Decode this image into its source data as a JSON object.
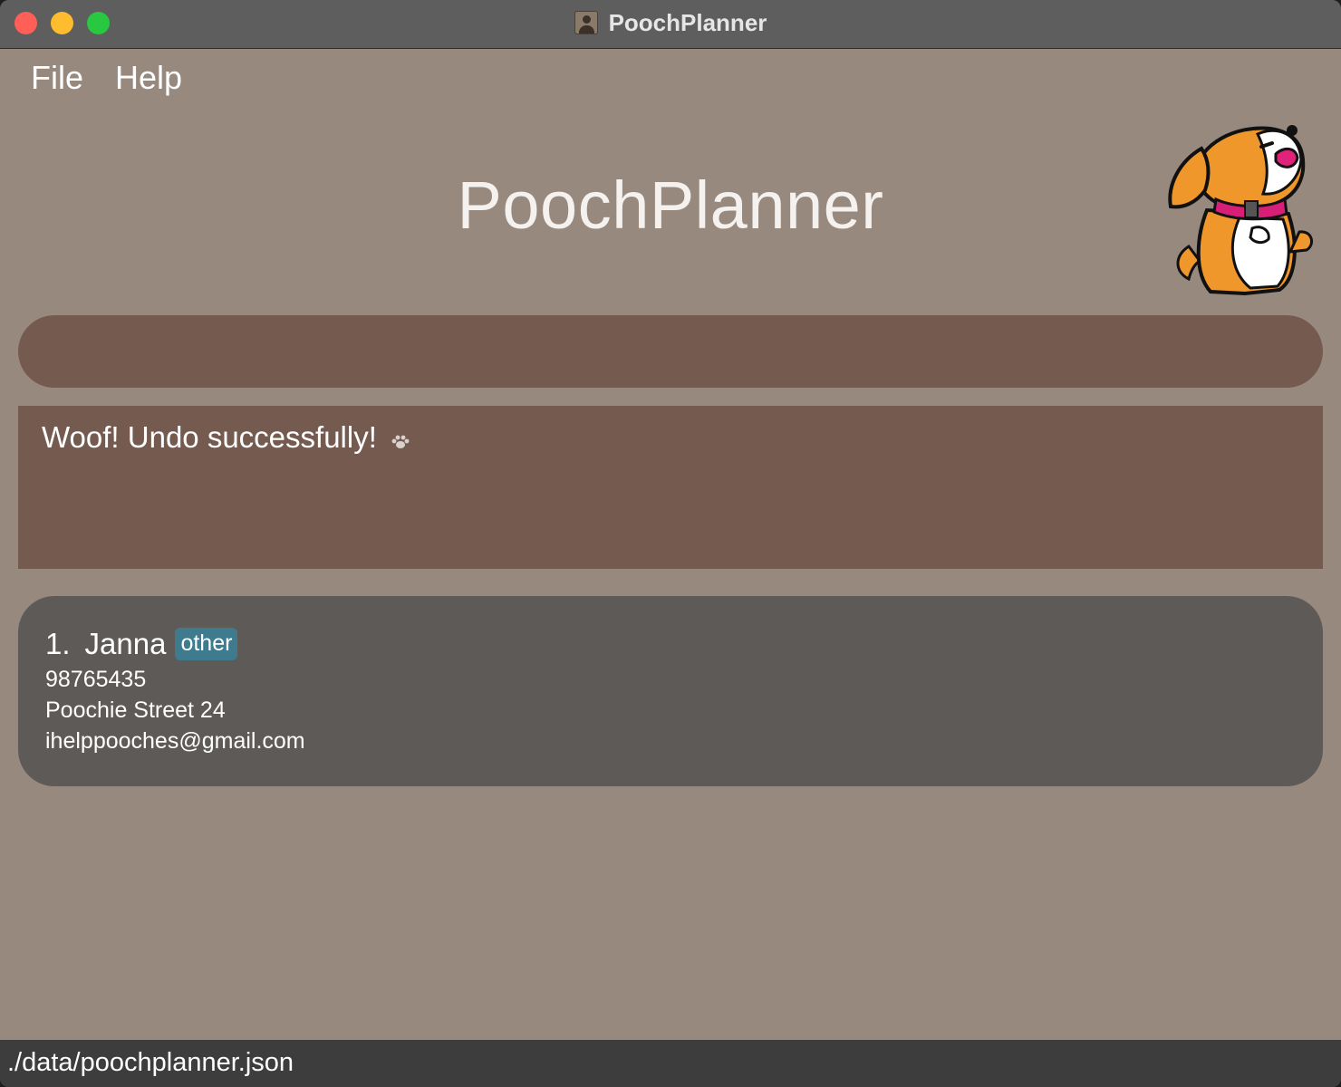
{
  "window": {
    "title": "PoochPlanner"
  },
  "menu": {
    "file": "File",
    "help": "Help"
  },
  "header": {
    "title": "PoochPlanner"
  },
  "command": {
    "value": "",
    "placeholder": ""
  },
  "result": {
    "message": "Woof! Undo successfully!"
  },
  "persons": [
    {
      "index": "1.",
      "name": "Janna",
      "tag": "other",
      "phone": "98765435",
      "address": "Poochie Street 24",
      "email": "ihelppooches@gmail.com"
    }
  ],
  "status": {
    "file_path": "./data/poochplanner.json"
  },
  "colors": {
    "window_bg": "#98897f",
    "command_bg": "#755b4f",
    "card_bg": "#5e5a57",
    "tag_bg": "#3f7b8f",
    "status_bg": "#3d3d3d"
  },
  "icons": {
    "mascot": "dog-mascot-icon",
    "paw": "paw-icon"
  }
}
